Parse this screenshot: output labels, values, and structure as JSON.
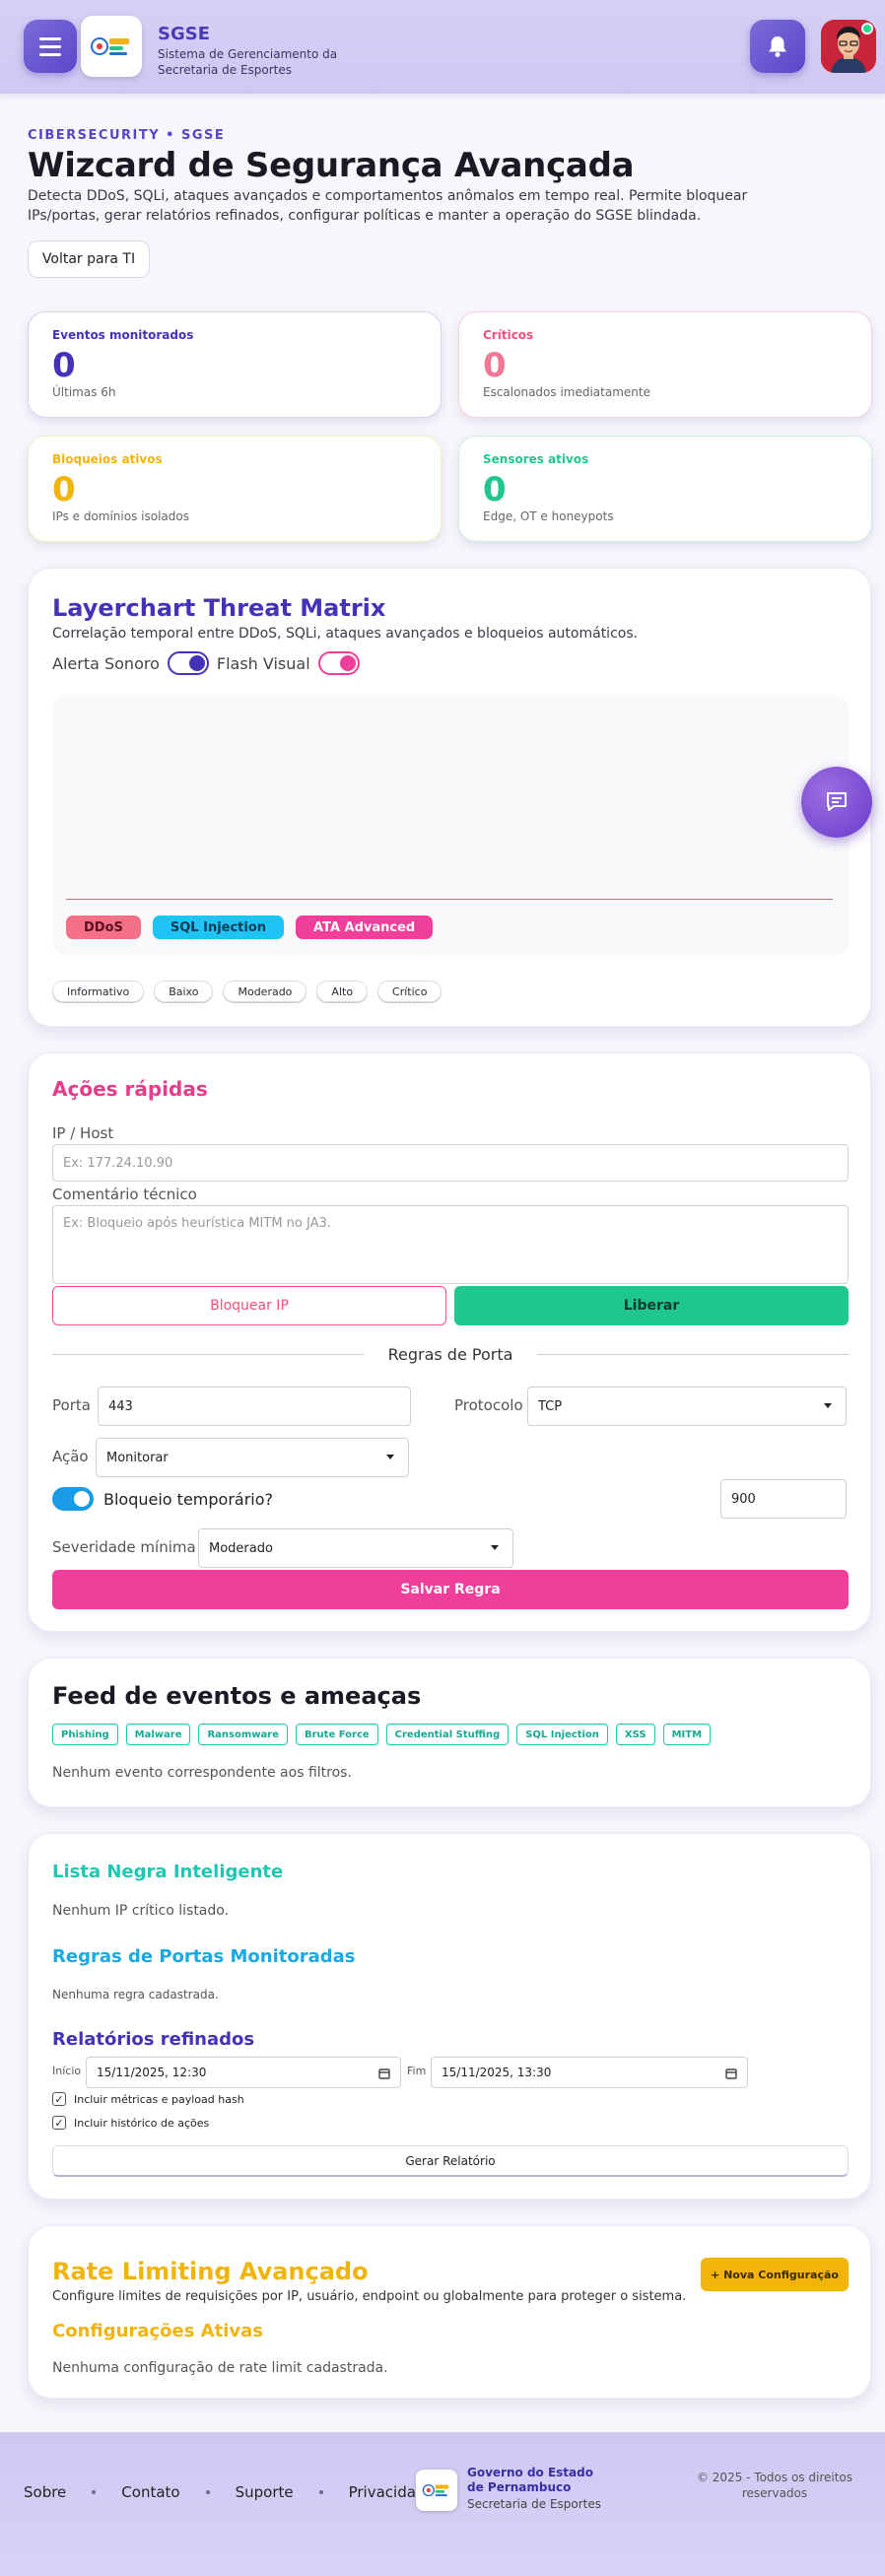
{
  "header": {
    "brand": "SGSE",
    "subtitle": "Sistema de Gerenciamento da Secretaria de Esportes"
  },
  "hero": {
    "eyebrow": "CIBERSECURITY • SGSE",
    "title": "Wizcard de Segurança Avançada",
    "description": "Detecta DDoS, SQLi, ataques avançados e comportamentos anômalos em tempo real. Permite bloquear IPs/portas, gerar relatórios refinados, configurar políticas e manter a operação do SGSE blindada.",
    "back_button": "Voltar para TI"
  },
  "stats": [
    {
      "label": "Eventos monitorados",
      "value": "0",
      "note": "Últimas 6h",
      "color": "#4433b8"
    },
    {
      "label": "Críticos",
      "value": "0",
      "note": "Escalonados imediatamente",
      "color": "#f0507a"
    },
    {
      "label": "Bloqueios ativos",
      "value": "0",
      "note": "IPs e domínios isolados",
      "color": "#f2b30a"
    },
    {
      "label": "Sensores ativos",
      "value": "0",
      "note": "Edge, OT e honeypots",
      "color": "#1fc78c"
    }
  ],
  "threat_matrix": {
    "title": "Layerchart Threat Matrix",
    "subtitle": "Correlação temporal entre DDoS, SQLi, ataques avançados e bloqueios automáticos.",
    "toggle_sound": "Alerta Sonoro",
    "toggle_flash": "Flash Visual",
    "legend": [
      {
        "label": "DDoS",
        "color": "#f56f86"
      },
      {
        "label": "SQL Injection",
        "color": "#20c4f4"
      },
      {
        "label": "ATA Advanced",
        "color": "#ef3f9a"
      }
    ],
    "severity": [
      "Informativo",
      "Baixo",
      "Moderado",
      "Alto",
      "Crítico"
    ]
  },
  "quick_actions": {
    "title": "Ações rápidas",
    "ip_label": "IP / Host",
    "ip_placeholder": "Ex: 177.24.10.90",
    "comment_label": "Comentário técnico",
    "comment_placeholder": "Ex: Bloqueio após heurística MITM no JA3.",
    "block_button": "Bloquear IP",
    "release_button": "Liberar",
    "port_rules_title": "Regras de Porta",
    "port_label": "Porta",
    "port_value": "443",
    "protocol_label": "Protocolo",
    "protocol_value": "TCP",
    "action_label": "Ação",
    "action_value": "Monitorar",
    "temp_block_label": "Bloqueio temporário?",
    "temp_block_value": "900",
    "severity_label": "Severidade mínima",
    "severity_value": "Moderado",
    "save_button": "Salvar Regra"
  },
  "feed": {
    "title": "Feed de eventos e ameaças",
    "filters": [
      "Phishing",
      "Malware",
      "Ransomware",
      "Brute Force",
      "Credential Stuffing",
      "SQL Injection",
      "XSS",
      "MITM"
    ],
    "empty": "Nenhum evento correspondente aos filtros."
  },
  "lists": {
    "blacklist_title": "Lista Negra Inteligente",
    "blacklist_empty": "Nenhum IP crítico listado.",
    "ports_title": "Regras de Portas Monitoradas",
    "ports_empty": "Nenhuma regra cadastrada.",
    "reports_title": "Relatórios refinados",
    "start_label": "Início",
    "start_value": "15/11/2025, 12:30",
    "end_label": "Fim",
    "end_value": "15/11/2025, 13:30",
    "check_metrics": "Incluir métricas e payload hash",
    "check_history": "Incluir histórico de ações",
    "generate_button": "Gerar Relatório"
  },
  "rate_limit": {
    "title": "Rate Limiting Avançado",
    "description": "Configure limites de requisições por IP, usuário, endpoint ou globalmente para proteger o sistema.",
    "new_button": "+ Nova Configuração",
    "active_title": "Configurações Ativas",
    "active_empty": "Nenhuma configuração de rate limit cadastrada."
  },
  "footer": {
    "links": [
      "Sobre",
      "Contato",
      "Suporte",
      "Privacidade"
    ],
    "gov": "Governo do Estado de Pernambuco",
    "secretaria": "Secretaria de Esportes",
    "copyright": "© 2025 - Todos os direitos reservados"
  }
}
